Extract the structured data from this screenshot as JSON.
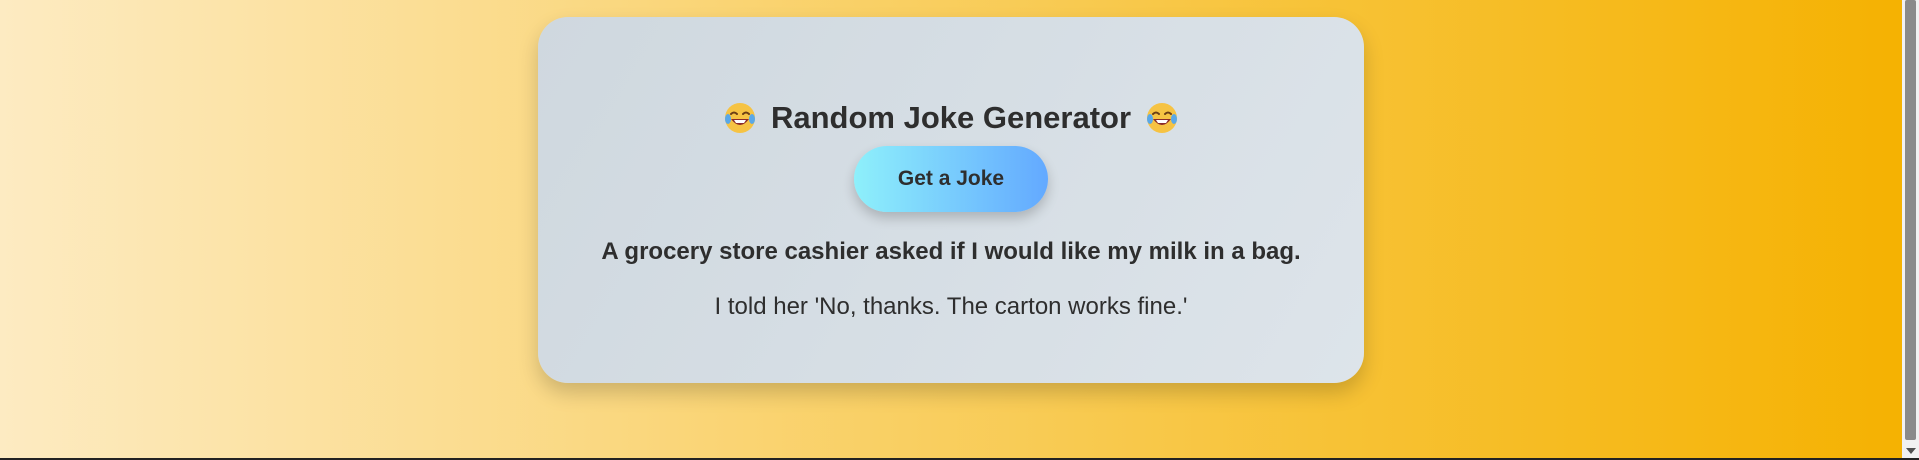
{
  "card": {
    "title": "Random Joke Generator",
    "title_emoji_icon": "face-with-tears-of-joy-icon",
    "button_label": "Get a Joke",
    "joke_setup": "A grocery store cashier asked if I would like my milk in a bag.",
    "joke_punchline": "I told her 'No, thanks. The carton works fine.'"
  },
  "colors": {
    "background_start": "#fdebc2",
    "background_end": "#f5b100",
    "card": "#d6dee4",
    "button_start": "#8ef0fb",
    "button_end": "#63a9ff",
    "text": "#2e2e2e"
  }
}
